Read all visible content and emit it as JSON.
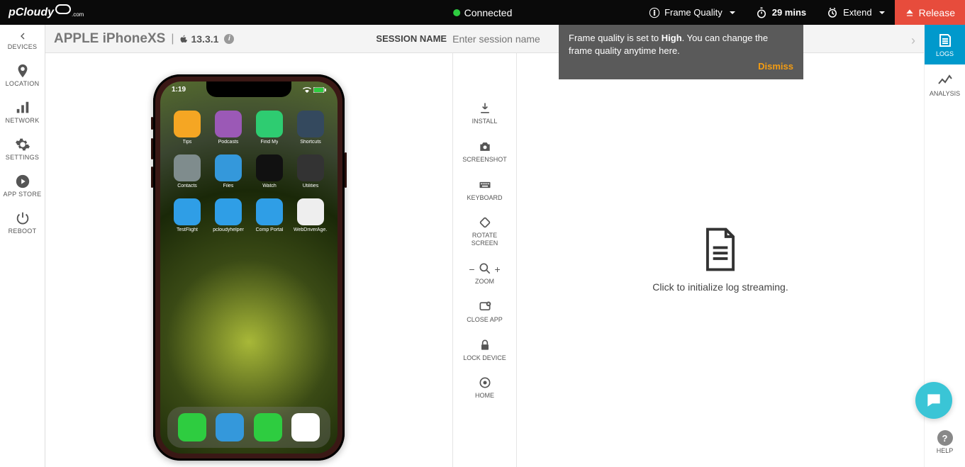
{
  "brand": "pCloudy",
  "brand_sub": ".com",
  "connection": "Connected",
  "topbar": {
    "frame_quality": "Frame Quality",
    "timer": "29 mins",
    "extend": "Extend",
    "release": "Release"
  },
  "sidebar_left": [
    {
      "id": "devices",
      "label": "DEVICES"
    },
    {
      "id": "location",
      "label": "LOCATION"
    },
    {
      "id": "network",
      "label": "NETWORK"
    },
    {
      "id": "settings",
      "label": "SETTINGS"
    },
    {
      "id": "appstore",
      "label": "APP STORE"
    },
    {
      "id": "reboot",
      "label": "REBOOT"
    }
  ],
  "device": {
    "brand": "APPLE",
    "model": "iPhoneXS",
    "os": "13.3.1"
  },
  "session": {
    "label": "SESSION NAME",
    "placeholder": "Enter session name"
  },
  "tooltip": {
    "text_before": "Frame quality is set to ",
    "quality": "High",
    "text_after": ". You can change the frame quality anytime here.",
    "dismiss": "Dismiss"
  },
  "phone": {
    "time": "1:19",
    "apps": [
      {
        "label": "Tips",
        "bg": "#f5a623"
      },
      {
        "label": "Podcasts",
        "bg": "#9b59b6"
      },
      {
        "label": "Find My",
        "bg": "#2ecc71"
      },
      {
        "label": "Shortcuts",
        "bg": "#34495e"
      },
      {
        "label": "Contacts",
        "bg": "#7f8c8d"
      },
      {
        "label": "Files",
        "bg": "#3498db"
      },
      {
        "label": "Watch",
        "bg": "#111"
      },
      {
        "label": "Utilities",
        "bg": "#333"
      },
      {
        "label": "TestFlight",
        "bg": "#2f9ee6"
      },
      {
        "label": "pcloudyhelper",
        "bg": "#2f9ee6"
      },
      {
        "label": "Comp Portal",
        "bg": "#2f9ee6"
      },
      {
        "label": "WebDriverAge...",
        "bg": "#eee"
      }
    ],
    "dock": [
      {
        "id": "phone",
        "bg": "#2ecc40"
      },
      {
        "id": "safari",
        "bg": "#3498db"
      },
      {
        "id": "messages",
        "bg": "#2ecc40"
      },
      {
        "id": "music",
        "bg": "#fff"
      }
    ]
  },
  "controls": [
    {
      "id": "install",
      "label": "INSTALL"
    },
    {
      "id": "screenshot",
      "label": "SCREENSHOT"
    },
    {
      "id": "keyboard",
      "label": "KEYBOARD"
    },
    {
      "id": "rotate",
      "label": "ROTATE\nSCREEN"
    },
    {
      "id": "zoom",
      "label": "ZOOM"
    },
    {
      "id": "closeapp",
      "label": "CLOSE APP"
    },
    {
      "id": "lock",
      "label": "LOCK DEVICE"
    },
    {
      "id": "home",
      "label": "HOME"
    }
  ],
  "logs_panel": {
    "message": "Click to initialize log streaming."
  },
  "rail_right": [
    {
      "id": "logs",
      "label": "LOGS"
    },
    {
      "id": "analysis",
      "label": "ANALYSIS"
    }
  ],
  "help_label": "HELP"
}
